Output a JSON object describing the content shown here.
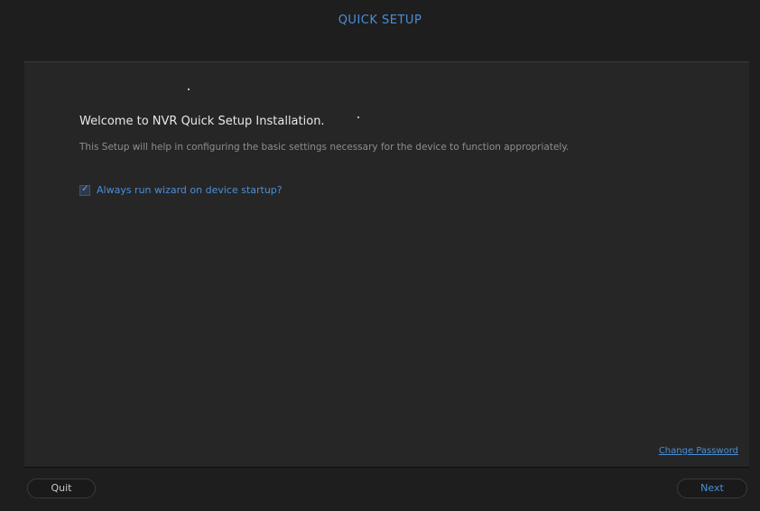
{
  "header": {
    "title": "QUICK SETUP"
  },
  "main": {
    "welcome_text": "Welcome to NVR  Quick Setup Installation.",
    "description": "This Setup will help in configuring the basic settings necessary for the device to function appropriately.",
    "wizard_checkbox": {
      "label": "Always run wizard on device startup?",
      "checked": true
    },
    "change_password_link": "Change Password"
  },
  "footer": {
    "quit_label": "Quit",
    "next_label": "Next"
  },
  "colors": {
    "accent": "#4a8fd6",
    "background": "#1e1e1e",
    "panel": "#262626"
  }
}
